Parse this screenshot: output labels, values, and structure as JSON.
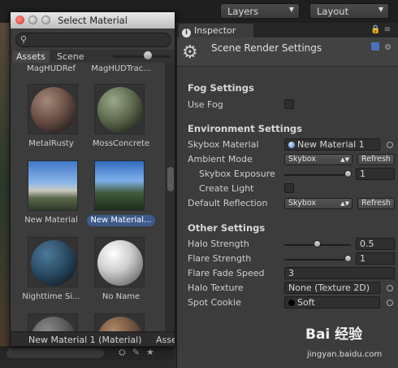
{
  "toolbar": {
    "layers_label": "Layers",
    "layout_label": "Layout"
  },
  "select_material": {
    "title": "Select Material",
    "search_placeholder": "",
    "tabs": [
      "Assets",
      "Scene"
    ],
    "items": [
      {
        "label": "MagHUDRef"
      },
      {
        "label": "MagHUDTrac..."
      },
      {
        "label": "MetalRusty"
      },
      {
        "label": "MossConcrete"
      },
      {
        "label": "New Material"
      },
      {
        "label": "New Material..."
      },
      {
        "label": "Nighttime Si..."
      },
      {
        "label": "No Name"
      }
    ],
    "selected_index": 5,
    "status": "New Material 1 (Material)",
    "status_extra": "Asse"
  },
  "inspector": {
    "tab_label": "Inspector",
    "title": "Scene Render Settings",
    "fog": {
      "section": "Fog Settings",
      "use_fog_label": "Use Fog",
      "use_fog": false
    },
    "environment": {
      "section": "Environment Settings",
      "skybox_material_label": "Skybox Material",
      "skybox_material_value": "New Material 1",
      "ambient_mode_label": "Ambient Mode",
      "ambient_mode_value": "Skybox",
      "refresh_label": "Refresh",
      "skybox_exposure_label": "Skybox Exposure",
      "skybox_exposure_value": "1",
      "skybox_exposure_fraction": 1.0,
      "create_light_label": "Create Light",
      "create_light": false,
      "default_reflection_label": "Default Reflection",
      "default_reflection_value": "Skybox",
      "refresh2_label": "Refresh"
    },
    "other": {
      "section": "Other Settings",
      "halo_strength_label": "Halo Strength",
      "halo_strength_value": "0.5",
      "halo_strength_fraction": 0.5,
      "flare_strength_label": "Flare Strength",
      "flare_strength_value": "1",
      "flare_strength_fraction": 1.0,
      "flare_fade_speed_label": "Flare Fade Speed",
      "flare_fade_speed_value": "3",
      "halo_texture_label": "Halo Texture",
      "halo_texture_value": "None (Texture 2D)",
      "spot_cookie_label": "Spot Cookie",
      "spot_cookie_value": "Soft"
    }
  },
  "watermark": {
    "logo": "Bai 经验",
    "url": "jingyan.baidu.com"
  },
  "colors": {
    "selection": "#3d5b8c",
    "panel": "#3c3c3c"
  }
}
